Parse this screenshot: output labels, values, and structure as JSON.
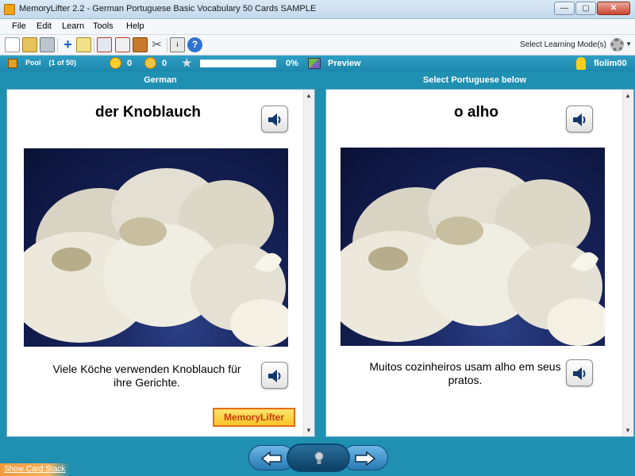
{
  "window": {
    "title": "MemoryLifter 2.2 - German Portuguese Basic Vocabulary 50 Cards SAMPLE",
    "minimize": "—",
    "maximize": "▢",
    "close": "✕"
  },
  "menu": {
    "file": "File",
    "edit": "Edit",
    "learn": "Learn",
    "tools": "Tools",
    "help": "Help"
  },
  "toolbar": {
    "learning_mode": "Select Learning Mode(s)",
    "add_label": "+",
    "help_label": "?",
    "info_label": "i",
    "tools_label": "✂"
  },
  "status": {
    "pool_label": "Pool",
    "pool_count": "(1 of 50)",
    "correct_count": "0",
    "wrong_count": "0",
    "star": "★",
    "progress_text": "0%",
    "progress_value": 0,
    "preview_label": "Preview",
    "user_name": "flolim00"
  },
  "columns": {
    "left_header": "German",
    "right_header": "Select Portuguese below"
  },
  "left_card": {
    "word": "der Knoblauch",
    "sentence": "Viele Köche verwenden Knoblauch für ihre Gerichte.",
    "logo": "MemoryLifter"
  },
  "right_card": {
    "word": "o alho",
    "sentence": "Muitos cozinheiros usam alho em seus pratos."
  },
  "bottom": {
    "show_card_stack": "Show Card Stack"
  },
  "icons": {
    "sound": "speaker-icon",
    "prev": "arrow-left-icon",
    "next": "arrow-right-icon",
    "hint": "lightbulb-icon",
    "gear": "gear-icon",
    "user": "user-icon"
  },
  "colors": {
    "accent": "#1f8fb2",
    "status_bar": "#2f9fc4",
    "logo_border": "#e86b17"
  }
}
